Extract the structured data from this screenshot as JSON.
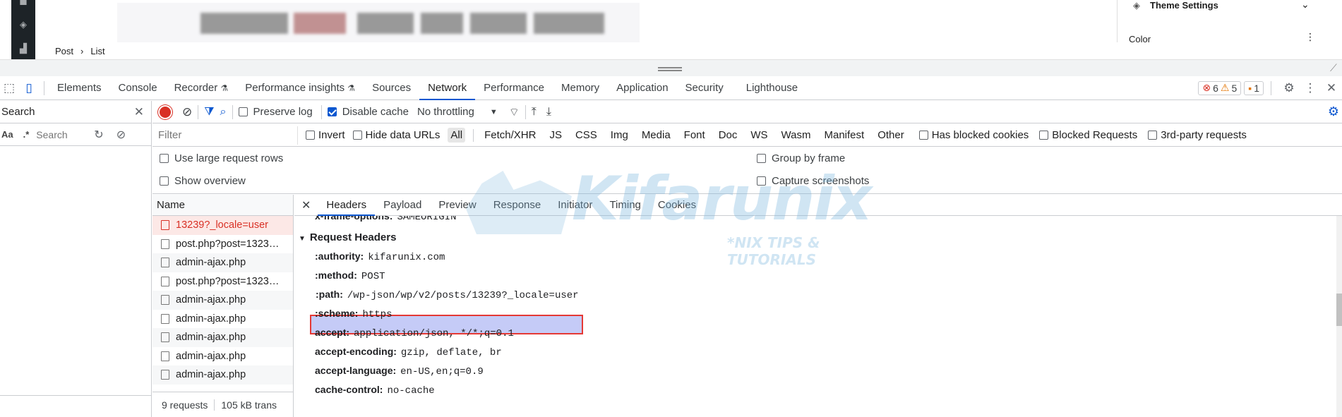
{
  "page": {
    "breadcrumb": [
      "Post",
      "List"
    ],
    "theme_settings": "Theme Settings",
    "color_label": "Color"
  },
  "tabs": [
    {
      "label": "Elements"
    },
    {
      "label": "Console"
    },
    {
      "label": "Recorder"
    },
    {
      "label": "Performance insights"
    },
    {
      "label": "Sources"
    },
    {
      "label": "Network"
    },
    {
      "label": "Performance"
    },
    {
      "label": "Memory"
    },
    {
      "label": "Application"
    },
    {
      "label": "Security"
    },
    {
      "label": "Lighthouse"
    }
  ],
  "badges": {
    "errors": "6",
    "warnings": "5",
    "issues": "1"
  },
  "search": {
    "title": "Search",
    "placeholder": "Search",
    "case": "Aa",
    "regex": ".*"
  },
  "toolbar": {
    "preserve_log": "Preserve log",
    "disable_cache": "Disable cache",
    "throttling": "No throttling"
  },
  "filter": {
    "placeholder": "Filter",
    "invert": "Invert",
    "hide_data_urls": "Hide data URLs",
    "types": [
      "All",
      "Fetch/XHR",
      "JS",
      "CSS",
      "Img",
      "Media",
      "Font",
      "Doc",
      "WS",
      "Wasm",
      "Manifest",
      "Other"
    ],
    "has_blocked_cookies": "Has blocked cookies",
    "blocked_requests": "Blocked Requests",
    "third_party": "3rd-party requests"
  },
  "options": {
    "large_rows": "Use large request rows",
    "show_overview": "Show overview",
    "group_by_frame": "Group by frame",
    "capture_screenshots": "Capture screenshots"
  },
  "requests": {
    "header": "Name",
    "items": [
      "13239?_locale=user",
      "post.php?post=1323…",
      "admin-ajax.php",
      "post.php?post=1323…",
      "admin-ajax.php",
      "admin-ajax.php",
      "admin-ajax.php",
      "admin-ajax.php",
      "admin-ajax.php"
    ],
    "count": "9 requests",
    "transferred": "105 kB trans"
  },
  "detail_tabs": [
    "Headers",
    "Payload",
    "Preview",
    "Response",
    "Initiator",
    "Timing",
    "Cookies"
  ],
  "headers": {
    "cut_line_key": "x-frame-options:",
    "cut_line_value": "SAMEORIGIN",
    "section": "Request Headers",
    "rows": [
      {
        "k": ":authority:",
        "v": "kifarunix.com"
      },
      {
        "k": ":method:",
        "v": "POST"
      },
      {
        "k": ":path:",
        "v": "/wp-json/wp/v2/posts/13239?_locale=user"
      },
      {
        "k": ":scheme:",
        "v": "https"
      },
      {
        "k": "accept:",
        "v": "application/json, */*;q=0.1"
      },
      {
        "k": "accept-encoding:",
        "v": "gzip, deflate, br"
      },
      {
        "k": "accept-language:",
        "v": "en-US,en;q=0.9"
      },
      {
        "k": "cache-control:",
        "v": "no-cache"
      }
    ]
  },
  "watermark": {
    "brand": "Kifarunix",
    "tagline": "*NIX TIPS & TUTORIALS"
  },
  "colors": {
    "accent": "#0b57d0",
    "error": "#d93025",
    "highlight": "#c5cbf7",
    "highlight_border": "#e53935"
  }
}
